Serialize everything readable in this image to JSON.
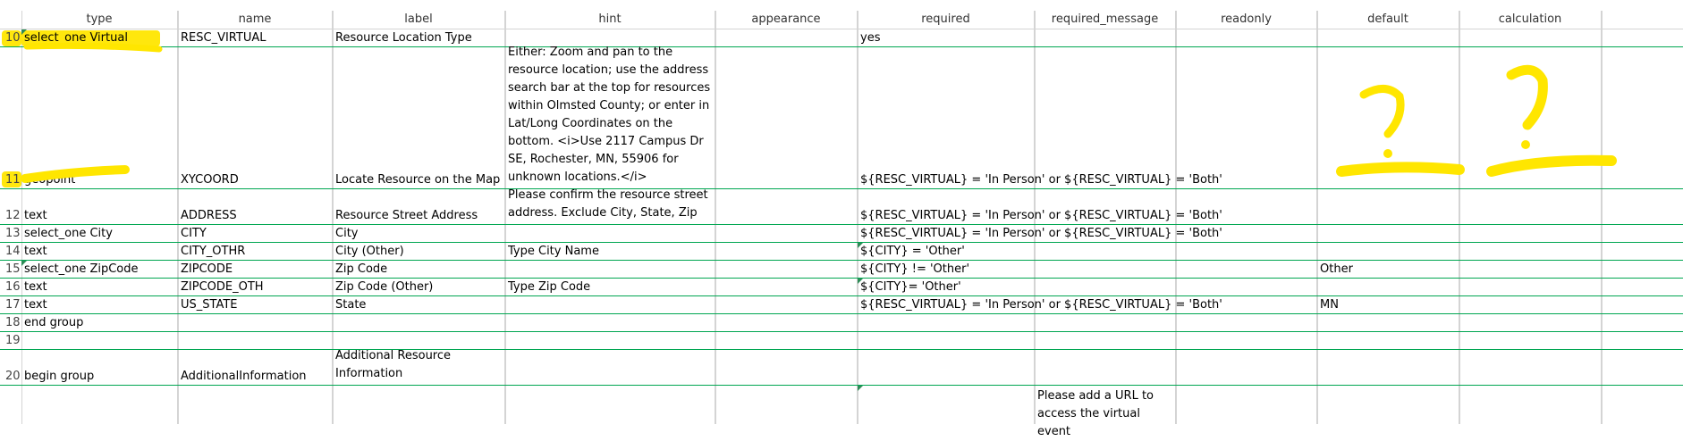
{
  "columns": [
    {
      "label": "type"
    },
    {
      "label": "name"
    },
    {
      "label": "label"
    },
    {
      "label": "hint"
    },
    {
      "label": "appearance"
    },
    {
      "label": "required"
    },
    {
      "label": "required_message"
    },
    {
      "label": "readonly"
    },
    {
      "label": "default"
    },
    {
      "label": "calculation"
    }
  ],
  "rows": [
    {
      "num": "10",
      "type": "select_one Virtual",
      "name": "RESC_VIRTUAL",
      "label": "Resource Location Type",
      "hint": "",
      "appearance": "",
      "required": "yes",
      "required_message": "",
      "readonly": "",
      "default": "",
      "calculation": ""
    },
    {
      "num": "11",
      "type": "geopoint",
      "name": "XYCOORD",
      "label": "Locate Resource on the Map",
      "hint": "Either: Zoom and pan to the resource location; use the address search bar at the top for resources within Olmsted County; or enter in Lat/Long Coordinates  on the bottom.  <i>Use 2117 Campus Dr SE, Rochester, MN, 55906 for unknown locations.</i>",
      "appearance": "",
      "required": "${RESC_VIRTUAL} = 'In Person' or ${RESC_VIRTUAL} = 'Both'",
      "required_message": "",
      "readonly": "",
      "default": "",
      "calculation": ""
    },
    {
      "num": "12",
      "type": "text",
      "name": "ADDRESS",
      "label": "Resource Street Address",
      "hint": "Please confirm the resource street address. Exclude City, State, Zip",
      "appearance": "",
      "required": "${RESC_VIRTUAL} = 'In Person' or ${RESC_VIRTUAL} = 'Both'",
      "required_message": "",
      "readonly": "",
      "default": "",
      "calculation": ""
    },
    {
      "num": "13",
      "type": "select_one City",
      "name": "CITY",
      "label": "City",
      "hint": "",
      "appearance": "",
      "required": "${RESC_VIRTUAL} = 'In Person' or ${RESC_VIRTUAL} = 'Both'",
      "required_message": "",
      "readonly": "",
      "default": "",
      "calculation": ""
    },
    {
      "num": "14",
      "type": "text",
      "name": "CITY_OTHR",
      "label": "City (Other)",
      "hint": "Type City Name",
      "appearance": "",
      "required": "${CITY} = 'Other'",
      "required_message": "",
      "readonly": "",
      "default": "",
      "calculation": ""
    },
    {
      "num": "15",
      "type": "select_one ZipCode",
      "name": "ZIPCODE",
      "label": "Zip Code",
      "hint": "",
      "appearance": "",
      "required": "${CITY} != 'Other'",
      "required_message": "",
      "readonly": "",
      "default": "Other",
      "calculation": ""
    },
    {
      "num": "16",
      "type": "text",
      "name": "ZIPCODE_OTH",
      "label": "Zip Code (Other)",
      "hint": "Type Zip Code",
      "appearance": "",
      "required": "${CITY}= 'Other'",
      "required_message": "",
      "readonly": "",
      "default": "",
      "calculation": ""
    },
    {
      "num": "17",
      "type": "text",
      "name": "US_STATE",
      "label": "State",
      "hint": "",
      "appearance": "",
      "required": "${RESC_VIRTUAL} = 'In Person' or ${RESC_VIRTUAL} = 'Both'",
      "required_message": "",
      "readonly": "",
      "default": "MN",
      "calculation": ""
    },
    {
      "num": "18",
      "type": "end group",
      "name": "",
      "label": "",
      "hint": "",
      "appearance": "",
      "required": "",
      "required_message": "",
      "readonly": "",
      "default": "",
      "calculation": ""
    },
    {
      "num": "19",
      "type": "",
      "name": "",
      "label": "",
      "hint": "",
      "appearance": "",
      "required": "",
      "required_message": "",
      "readonly": "",
      "default": "",
      "calculation": ""
    },
    {
      "num": "20",
      "type": "begin group",
      "name": "AdditionalInformation",
      "label": "Additional Resource Information",
      "hint": "",
      "appearance": "",
      "required": "",
      "required_message": "",
      "readonly": "",
      "default": "",
      "calculation": ""
    },
    {
      "num": "",
      "type": "",
      "name": "",
      "label": "",
      "hint": "",
      "appearance": "",
      "required": "",
      "required_message": "Please add a URL to access the virtual event",
      "readonly": "",
      "default": "",
      "calculation": ""
    }
  ],
  "colors": {
    "grid": "#d4d4d4",
    "row_border": "#00a651",
    "highlight": "#ffe600",
    "comment_marker": "#2e8b57"
  }
}
